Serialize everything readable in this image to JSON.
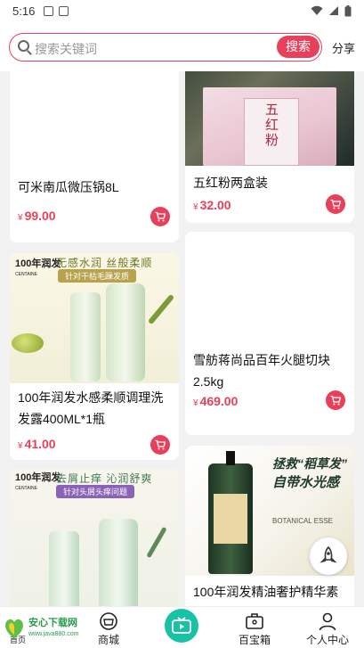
{
  "status": {
    "time": "5:16"
  },
  "search": {
    "placeholder": "搜索关键词",
    "button": "搜索"
  },
  "header": {
    "share": "分享"
  },
  "products": [
    {
      "name": "可米南瓜微压锅8L",
      "price": "99.00"
    },
    {
      "name": "五红粉两盒装",
      "price": "32.00"
    },
    {
      "name": "100年润发水感柔顺调理洗发露400ML*1瓶",
      "price": "41.00"
    },
    {
      "name": "雪舫蒋尚品百年火腿切块2.5kg",
      "price": "469.00"
    },
    {
      "name": "100年润发精油奢护精华素",
      "price": ""
    },
    {
      "name": "",
      "price": ""
    }
  ],
  "images": {
    "p2": {
      "label": "五红粉"
    },
    "p3": {
      "brand": "100年润发",
      "brand_en": "CENTAINE",
      "slogan": "无感水润 丝般柔顺",
      "sub": "针对干枯毛躁发质"
    },
    "p5": {
      "slogan": "拯救“稻草发”",
      "slogan2": "自带水光感",
      "sub": "BOTANICAL ESSE"
    },
    "p6": {
      "brand": "100年润发",
      "brand_en": "CENTAINE",
      "slogan": "去屑止痒 沁润舒爽",
      "sub": "针对头屑头痒问题"
    }
  },
  "currency": "¥",
  "tabs": [
    "首页",
    "商城",
    "",
    "百宝箱",
    "个人中心"
  ],
  "watermark": {
    "title": "安心下载网",
    "url": "www.java880.com"
  },
  "colors": {
    "accent": "#e8405a",
    "teal": "#17c3a6"
  }
}
